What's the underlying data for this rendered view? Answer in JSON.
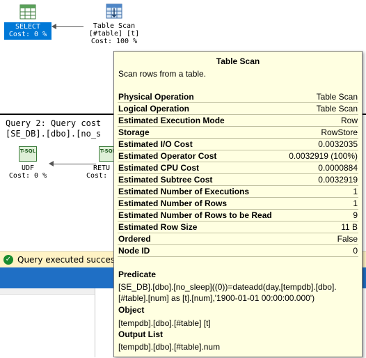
{
  "plan": {
    "select_node": {
      "label": "SELECT",
      "cost": "Cost: 0 %"
    },
    "scan_node": {
      "label": "Table Scan",
      "object": "[#table] [t]",
      "cost": "Cost: 100 %"
    },
    "query2_header": [
      "Query 2: Query cost",
      "[SE_DB].[dbo].[no_s"
    ],
    "udf_node": {
      "icon_text": "T-SQL",
      "label": "UDF",
      "cost": "Cost: 0 %"
    },
    "return_node": {
      "icon_text": "T-SQL",
      "label": "RETU",
      "cost": "Cost:"
    }
  },
  "status": {
    "message": "Query executed successful",
    "icon": "check-icon"
  },
  "tooltip": {
    "title": "Table Scan",
    "description": "Scan rows from a table.",
    "properties": [
      {
        "name": "Physical Operation",
        "value": "Table Scan"
      },
      {
        "name": "Logical Operation",
        "value": "Table Scan"
      },
      {
        "name": "Estimated Execution Mode",
        "value": "Row"
      },
      {
        "name": "Storage",
        "value": "RowStore"
      },
      {
        "name": "Estimated I/O Cost",
        "value": "0.0032035"
      },
      {
        "name": "Estimated Operator Cost",
        "value": "0.0032919 (100%)"
      },
      {
        "name": "Estimated CPU Cost",
        "value": "0.0000884"
      },
      {
        "name": "Estimated Subtree Cost",
        "value": "0.0032919"
      },
      {
        "name": "Estimated Number of Executions",
        "value": "1"
      },
      {
        "name": "Estimated Number of Rows",
        "value": "1"
      },
      {
        "name": "Estimated Number of Rows to be Read",
        "value": "9"
      },
      {
        "name": "Estimated Row Size",
        "value": "11 B"
      },
      {
        "name": "Ordered",
        "value": "False"
      },
      {
        "name": "Node ID",
        "value": "0"
      }
    ],
    "predicate_heading": "Predicate",
    "predicate": "[SE_DB].[dbo].[no_sleep]((0))=dateadd(day,[tempdb].[dbo].[#table].[num] as [t].[num],'1900-01-01 00:00:00.000')",
    "object_heading": "Object",
    "object": "[tempdb].[dbo].[#table] [t]",
    "output_heading": "Output List",
    "output": "[tempdb].[dbo].[#table].num"
  }
}
